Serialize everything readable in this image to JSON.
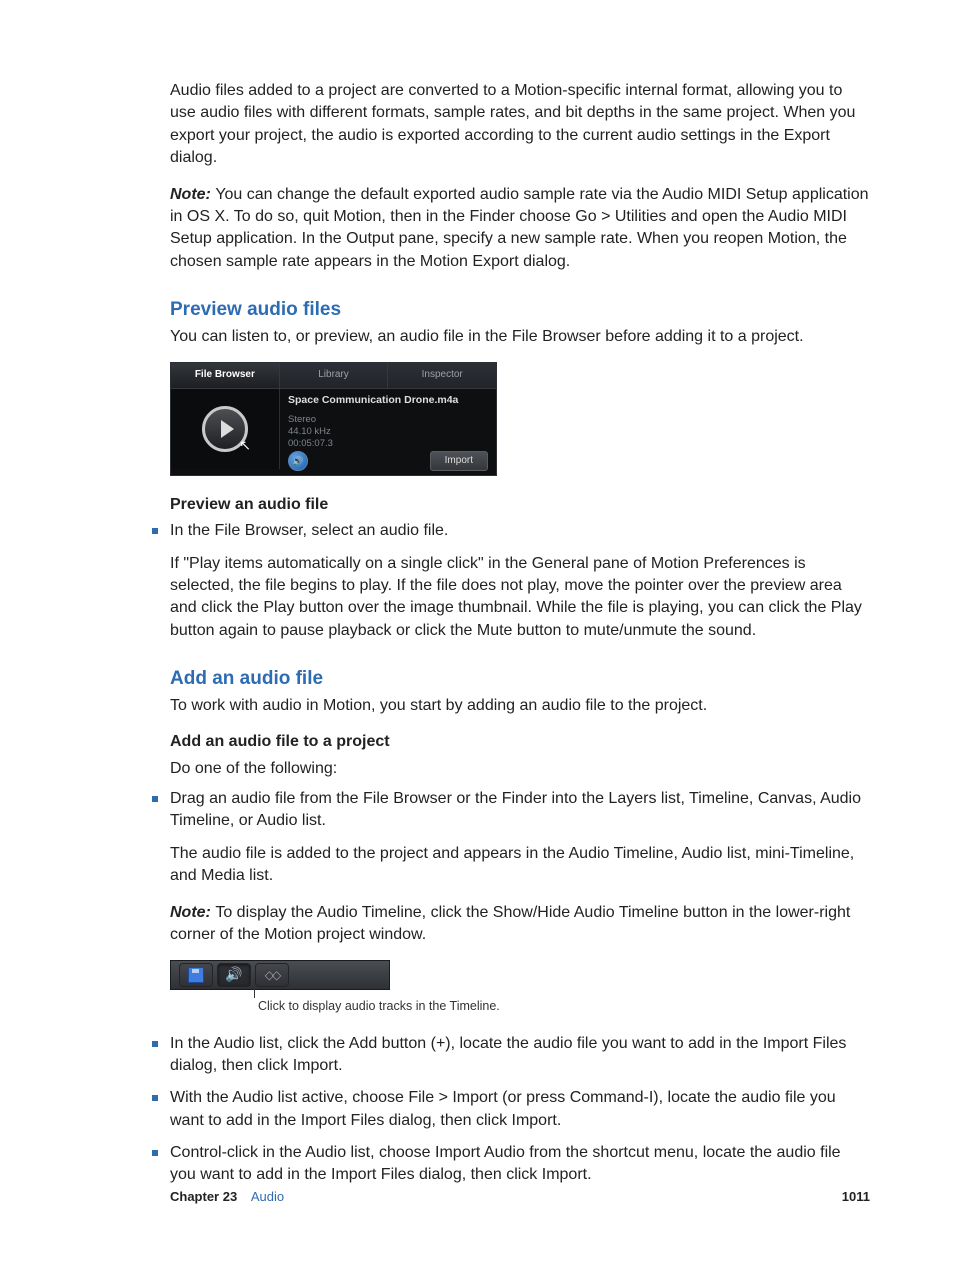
{
  "paragraphs": {
    "intro": "Audio files added to a project are converted to a Motion-specific internal format, allowing you to use audio files with different formats, sample rates, and bit depths in the same project. When you export your project, the audio is exported according to the current audio settings in the Export dialog.",
    "note1_label": "Note:  ",
    "note1": "You can change the default exported audio sample rate via the Audio MIDI Setup application in OS X. To do so, quit Motion, then in the Finder choose Go > Utilities and open the Audio MIDI Setup application. In the Output pane, specify a new sample rate. When you reopen Motion, the chosen sample rate appears in the Motion Export dialog."
  },
  "section_preview": {
    "heading": "Preview audio files",
    "intro": "You can listen to, or preview, an audio file in the File Browser before adding it to a project.",
    "subhead": "Preview an audio file",
    "bullet1": "In the File Browser, select an audio file.",
    "bullet1_body": "If \"Play items automatically on a single click\" in the General pane of Motion Preferences is selected, the file begins to play. If the file does not play, move the pointer over the preview area and click the Play button over the image thumbnail. While the file is playing, you can click the Play button again to pause playback or click the Mute button to mute/unmute the sound."
  },
  "file_browser": {
    "tabs": {
      "a": "File Browser",
      "b": "Library",
      "c": "Inspector"
    },
    "filename": "Space Communication Drone.m4a",
    "meta1": "Stereo",
    "meta2": "44.10 kHz",
    "meta3": "00:05:07.3",
    "import": "Import"
  },
  "section_add": {
    "heading": "Add an audio file",
    "intro": "To work with audio in Motion, you start by adding an audio file to the project.",
    "subhead": "Add an audio file to a project",
    "lead": "Do one of the following:",
    "bullet1": "Drag an audio file from the File Browser or the Finder into the Layers list, Timeline, Canvas, Audio Timeline, or Audio list.",
    "bullet1_body1": "The audio file is added to the project and appears in the Audio Timeline, Audio list, mini-Timeline, and Media list.",
    "note2_label": "Note:  ",
    "bullet1_body2": "To display the Audio Timeline, click the Show/Hide Audio Timeline button in the lower-right corner of the Motion project window.",
    "toolbar_caption": "Click to display audio tracks in the Timeline.",
    "bullet2": "In the Audio list, click the Add button (+), locate the audio file you want to add in the Import Files dialog, then click Import.",
    "bullet3": "With the Audio list active, choose File > Import (or press Command-I), locate the audio file you want to add in the Import Files dialog, then click Import.",
    "bullet4": "Control-click in the Audio list, choose Import Audio from the shortcut menu, locate the audio file you want to add in the Import Files dialog, then click Import."
  },
  "footer": {
    "chapter_label": "Chapter 23",
    "chapter_name": "Audio",
    "page": "1011"
  }
}
